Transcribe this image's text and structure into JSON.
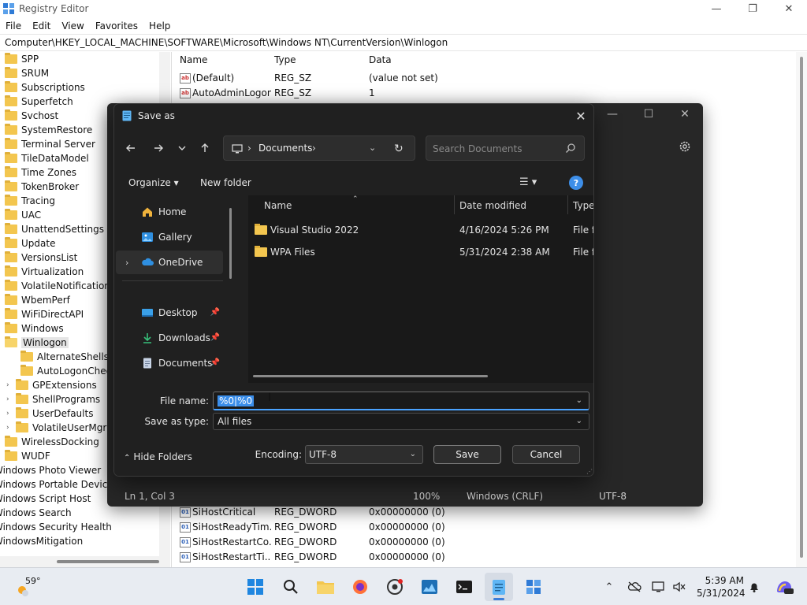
{
  "registry": {
    "title": "Registry Editor",
    "menu": [
      "File",
      "Edit",
      "View",
      "Favorites",
      "Help"
    ],
    "address": "Computer\\HKEY_LOCAL_MACHINE\\SOFTWARE\\Microsoft\\Windows NT\\CurrentVersion\\Winlogon",
    "tree": [
      "SPP",
      "SRUM",
      "Subscriptions",
      "Superfetch",
      "Svchost",
      "SystemRestore",
      "Terminal Server",
      "TileDataModel",
      "Time Zones",
      "TokenBroker",
      "Tracing",
      "UAC",
      "UnattendSettings",
      "Update",
      "VersionsList",
      "Virtualization",
      "VolatileNotifications",
      "WbemPerf",
      "WiFiDirectAPI",
      "Windows",
      "Winlogon"
    ],
    "winlogon_children": [
      "AlternateShells",
      "AutoLogonChecked",
      "GPExtensions",
      "ShellPrograms",
      "UserDefaults",
      "VolatileUserMgrKey"
    ],
    "tree_after": [
      "WirelessDocking",
      "WUDF"
    ],
    "tree_root": [
      "Windows Photo Viewer",
      "Windows Portable Devices",
      "Windows Script Host",
      "Windows Search",
      "Windows Security Health",
      "WindowsMitigation"
    ],
    "columns": {
      "name": "Name",
      "type": "Type",
      "data": "Data"
    },
    "values_top": [
      {
        "name": "(Default)",
        "type": "REG_SZ",
        "data": "(value not set)",
        "icon": "ab"
      },
      {
        "name": "AutoAdminLogon",
        "type": "REG_SZ",
        "data": "1",
        "icon": "ab"
      }
    ],
    "values_bottom": [
      {
        "name": "SiHostCritical",
        "type": "REG_DWORD",
        "data": "0x00000000 (0)",
        "icon": "01"
      },
      {
        "name": "SiHostReadyTim...",
        "type": "REG_DWORD",
        "data": "0x00000000 (0)",
        "icon": "01"
      },
      {
        "name": "SiHostRestartCo...",
        "type": "REG_DWORD",
        "data": "0x00000000 (0)",
        "icon": "01"
      },
      {
        "name": "SiHostRestartTi...",
        "type": "REG_DWORD",
        "data": "0x00000000 (0)",
        "icon": "01"
      }
    ]
  },
  "notepad": {
    "status": {
      "position": "Ln 1, Col 3",
      "zoom": "100%",
      "line_ending": "Windows (CRLF)",
      "encoding": "UTF-8"
    }
  },
  "dialog": {
    "title": "Save as",
    "close": "✕",
    "location": "Documents",
    "search_placeholder": "Search Documents",
    "organize": "Organize ▾",
    "new_folder": "New folder",
    "help": "?",
    "nav": [
      {
        "label": "Home"
      },
      {
        "label": "Gallery"
      },
      {
        "label": "OneDrive"
      },
      {
        "label": "Desktop"
      },
      {
        "label": "Downloads"
      },
      {
        "label": "Documents"
      }
    ],
    "columns": {
      "name": "Name",
      "date": "Date modified",
      "type": "Type"
    },
    "files": [
      {
        "name": "Visual Studio 2022",
        "date": "4/16/2024 5:26 PM",
        "type": "File folder"
      },
      {
        "name": "WPA Files",
        "date": "5/31/2024 2:38 AM",
        "type": "File folder"
      }
    ],
    "file_name_label": "File name:",
    "file_name_value": "%0|%0",
    "save_type_label": "Save as type:",
    "save_type_value": "All files",
    "hide_folders": "Hide Folders",
    "encoding_label": "Encoding:",
    "encoding_value": "UTF-8",
    "save": "Save",
    "cancel": "Cancel"
  },
  "taskbar": {
    "temperature": "59°",
    "time": "5:39 AM",
    "date": "5/31/2024"
  }
}
